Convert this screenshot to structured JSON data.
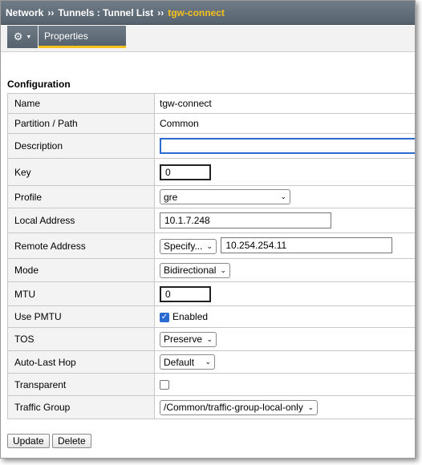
{
  "breadcrumb": {
    "items": [
      "Network",
      "Tunnels : Tunnel List",
      "tgw-connect"
    ],
    "separator": "››"
  },
  "tabs": {
    "gear_icon": "gear-icon",
    "properties_label": "Properties"
  },
  "section": {
    "title": "Configuration"
  },
  "fields": {
    "name": {
      "label": "Name",
      "value": "tgw-connect"
    },
    "partition": {
      "label": "Partition / Path",
      "value": "Common"
    },
    "description": {
      "label": "Description",
      "value": ""
    },
    "key": {
      "label": "Key",
      "value": "0"
    },
    "profile": {
      "label": "Profile",
      "value": "gre"
    },
    "local_address": {
      "label": "Local Address",
      "value": "10.1.7.248"
    },
    "remote_address": {
      "label": "Remote Address",
      "mode": "Specify...",
      "value": "10.254.254.11"
    },
    "mode": {
      "label": "Mode",
      "value": "Bidirectional"
    },
    "mtu": {
      "label": "MTU",
      "value": "0"
    },
    "use_pmtu": {
      "label": "Use PMTU",
      "checked": true,
      "value": "Enabled"
    },
    "tos": {
      "label": "TOS",
      "value": "Preserve"
    },
    "auto_last_hop": {
      "label": "Auto-Last Hop",
      "value": "Default"
    },
    "transparent": {
      "label": "Transparent",
      "checked": false
    },
    "traffic_group": {
      "label": "Traffic Group",
      "value": "/Common/traffic-group-local-only"
    }
  },
  "buttons": {
    "update": "Update",
    "delete": "Delete"
  },
  "colors": {
    "header_bg": "#5e6b77",
    "accent_yellow": "#f7c11d",
    "focus_blue": "#2a6ad1"
  }
}
